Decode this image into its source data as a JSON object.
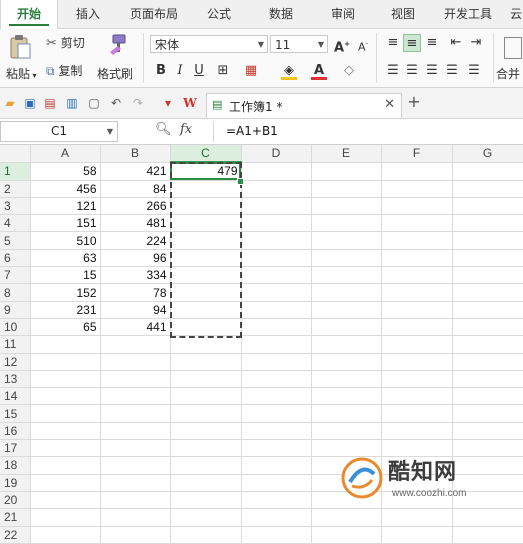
{
  "ribbon_tabs": [
    "开始",
    "插入",
    "页面布局",
    "公式",
    "数据",
    "审阅",
    "视图",
    "开发工具",
    "云"
  ],
  "active_tab": "开始",
  "ribbon": {
    "paste_label": "粘贴",
    "cut_label": "剪切",
    "copy_label": "复制",
    "format_painter_label": "格式刷",
    "font_name": "宋体",
    "font_size": "11",
    "merge_label": "合并"
  },
  "document": {
    "tab_title": "工作簿1 *"
  },
  "formula_bar": {
    "name_box": "C1",
    "fx_label": "fx",
    "formula": "=A1+B1"
  },
  "sheet": {
    "columns": [
      "A",
      "B",
      "C",
      "D",
      "E",
      "F",
      "G"
    ],
    "rows": [
      {
        "n": "1",
        "A": "58",
        "B": "421",
        "C": "479"
      },
      {
        "n": "2",
        "A": "456",
        "B": "84",
        "C": ""
      },
      {
        "n": "3",
        "A": "121",
        "B": "266",
        "C": ""
      },
      {
        "n": "4",
        "A": "151",
        "B": "481",
        "C": ""
      },
      {
        "n": "5",
        "A": "510",
        "B": "224",
        "C": ""
      },
      {
        "n": "6",
        "A": "63",
        "B": "96",
        "C": ""
      },
      {
        "n": "7",
        "A": "15",
        "B": "334",
        "C": ""
      },
      {
        "n": "8",
        "A": "152",
        "B": "78",
        "C": ""
      },
      {
        "n": "9",
        "A": "231",
        "B": "94",
        "C": ""
      },
      {
        "n": "10",
        "A": "65",
        "B": "441",
        "C": ""
      },
      {
        "n": "11",
        "A": "",
        "B": "",
        "C": ""
      },
      {
        "n": "12",
        "A": "",
        "B": "",
        "C": ""
      },
      {
        "n": "13",
        "A": "",
        "B": "",
        "C": ""
      },
      {
        "n": "14",
        "A": "",
        "B": "",
        "C": ""
      },
      {
        "n": "15",
        "A": "",
        "B": "",
        "C": ""
      },
      {
        "n": "16",
        "A": "",
        "B": "",
        "C": ""
      },
      {
        "n": "17",
        "A": "",
        "B": "",
        "C": ""
      },
      {
        "n": "18",
        "A": "",
        "B": "",
        "C": ""
      },
      {
        "n": "19",
        "A": "",
        "B": "",
        "C": ""
      },
      {
        "n": "20",
        "A": "",
        "B": "",
        "C": ""
      },
      {
        "n": "21",
        "A": "",
        "B": "",
        "C": ""
      },
      {
        "n": "22",
        "A": "",
        "B": "",
        "C": ""
      }
    ],
    "selected_column": "C",
    "selected_row": "1"
  },
  "watermark": {
    "title": "酷知网",
    "url": "www.coozhi.com"
  },
  "colors": {
    "accent": "#2a7d3d",
    "selection_header": "#dceedd"
  }
}
